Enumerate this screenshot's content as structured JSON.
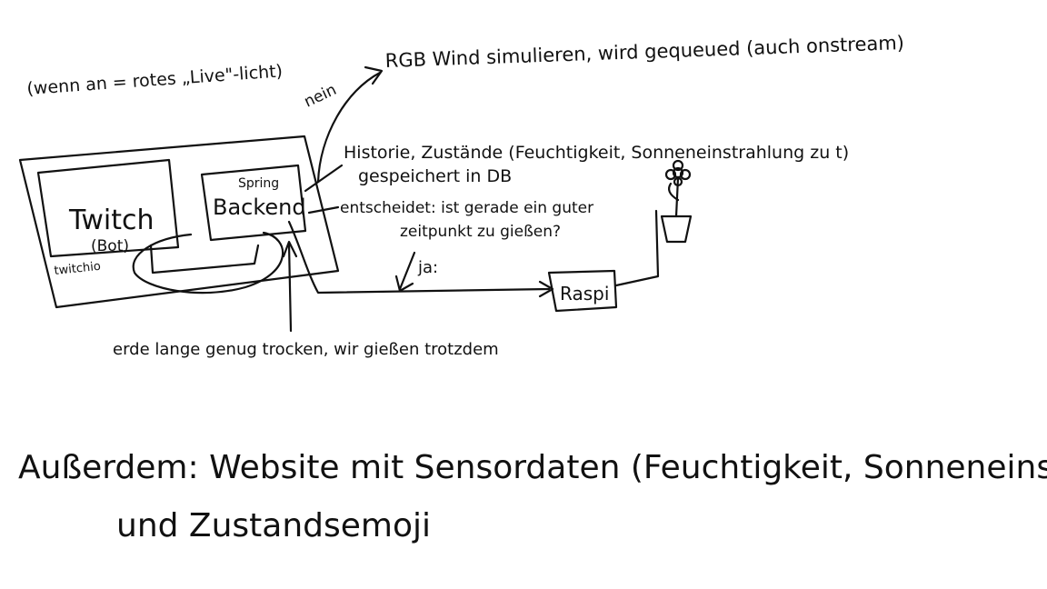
{
  "diagram": {
    "notes": {
      "live_light": "(wenn an = rotes „Live\"-licht)",
      "nein": "nein",
      "rgb_wind": "RGB Wind simulieren, wird gequeued (auch onstream)",
      "historie_line1": "Historie, Zustände (Feuchtigkeit, Sonneneinstrahlung zu t)",
      "historie_line2": "gespeichert in DB",
      "entscheidet_line1": "entscheidet: ist gerade ein guter",
      "entscheidet_line2": "zeitpunkt zu gießen?",
      "ja": "ja:",
      "erde": "erde lange genug trocken, wir gießen trotzdem",
      "ausserdem_line1": "Außerdem: Website mit Sensordaten (Feuchtigkeit, Sonneneinstrahlung)",
      "ausserdem_line2": "und Zustandsemoji"
    },
    "boxes": {
      "twitch": "Twitch",
      "bot": "(Bot)",
      "twitchio": "twitchio",
      "spring": "Spring",
      "backend": "Backend",
      "raspi": "Raspi"
    }
  }
}
